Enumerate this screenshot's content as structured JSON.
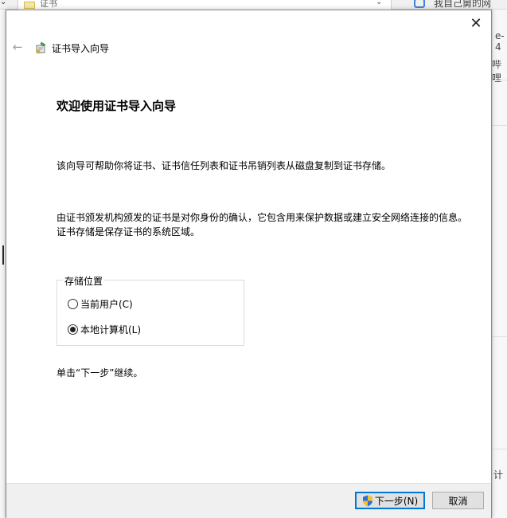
{
  "background": {
    "tab_label": "证书",
    "right_title": "我自己舅的网",
    "snippet_1": "e-4",
    "snippet_2": "哔哩",
    "snippet_3": "计"
  },
  "dialog": {
    "close_glyph": "✕",
    "back_glyph": "←",
    "wizard_title": "证书导入向导",
    "heading": "欢迎使用证书导入向导",
    "para1": "该向导可帮助你将证书、证书信任列表和证书吊销列表从磁盘复制到证书存储。",
    "para2": "由证书颁发机构颁发的证书是对你身份的确认，它包含用来保护数据或建立安全网络连接的信息。证书存储是保存证书的系统区域。",
    "store_group": {
      "legend": "存储位置",
      "options": [
        {
          "label": "当前用户(C)",
          "checked": false
        },
        {
          "label": "本地计算机(L)",
          "checked": true
        }
      ]
    },
    "continue_text": "单击“下一步”继续。",
    "buttons": {
      "next": "下一步(N)",
      "cancel": "取消"
    }
  },
  "icons": {
    "wizard": "certificate-wizard-icon",
    "shield": "uac-shield-icon",
    "close": "close-icon",
    "back": "back-arrow-icon"
  },
  "colors": {
    "accent": "#0078d7",
    "footer_bg": "#f0f0f0",
    "button_bg": "#e1e1e1",
    "shield_blue": "#2d6fd8",
    "shield_yellow": "#f2c230"
  }
}
